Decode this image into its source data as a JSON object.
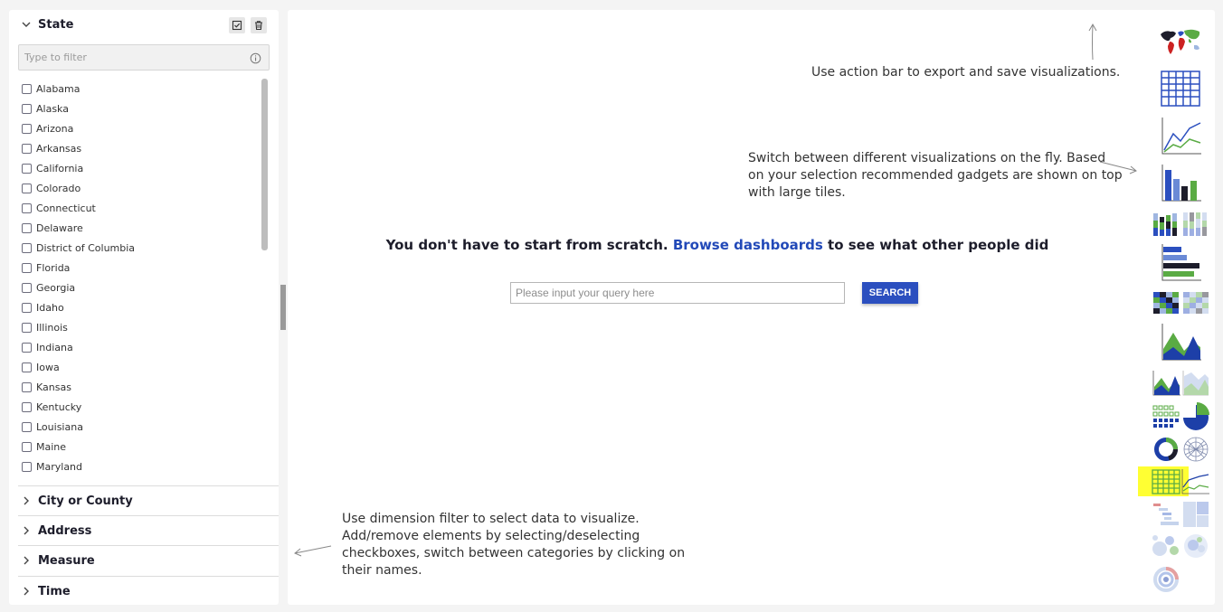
{
  "filter_panel": {
    "state_section": {
      "title": "State",
      "filter_placeholder": "Type to filter",
      "items": [
        "Alabama",
        "Alaska",
        "Arizona",
        "Arkansas",
        "California",
        "Colorado",
        "Connecticut",
        "Delaware",
        "District of Columbia",
        "Florida",
        "Georgia",
        "Idaho",
        "Illinois",
        "Indiana",
        "Iowa",
        "Kansas",
        "Kentucky",
        "Louisiana",
        "Maine",
        "Maryland"
      ]
    },
    "collapsed_sections": [
      "City or County",
      "Address",
      "Measure",
      "Time"
    ]
  },
  "hints": {
    "action_bar": "Use action bar to export and save visualizations.",
    "switch_viz_1": "Switch between different visualizations on the fly. Based",
    "switch_viz_2": "on your selection recommended gadgets are shown on top",
    "switch_viz_3": "with large tiles.",
    "dimension_1": "Use dimension filter to select data to visualize.",
    "dimension_2": "Add/remove elements by selecting/deselecting",
    "dimension_3": "checkboxes, switch between categories by clicking on",
    "dimension_4": "their names."
  },
  "main": {
    "scratch_prefix": "You don't have to start from scratch. ",
    "scratch_link": "Browse dashboards",
    "scratch_suffix": " to see what other people did",
    "query_placeholder": "Please input your query here",
    "search_label": "SEARCH"
  },
  "gadget_bar": {
    "gadgets": [
      "world-map-icon",
      "table-grid-icon",
      "line-chart-icon",
      "bar-chart-icon",
      "stacked-bar-icon",
      "stacked-bar-percent-icon",
      "horizontal-bar-icon",
      "heatmap-icon",
      "heatmap-percent-icon",
      "area-chart-icon",
      "area-chart-small-icon",
      "area-percent-icon",
      "dot-matrix-icon",
      "pie-chart-icon",
      "donut-chart-icon",
      "network-icon",
      "pivot-table-icon",
      "sparkline-icon",
      "gantt-icon",
      "treemap-icon",
      "bubble-icon",
      "packed-circle-icon",
      "sunburst-icon"
    ],
    "selected": "pivot-table-icon"
  },
  "colors": {
    "accent_blue": "#2b4fbf",
    "navy": "#1d1d2b",
    "green": "#5aab44",
    "highlight_yellow": "#ffff33"
  }
}
